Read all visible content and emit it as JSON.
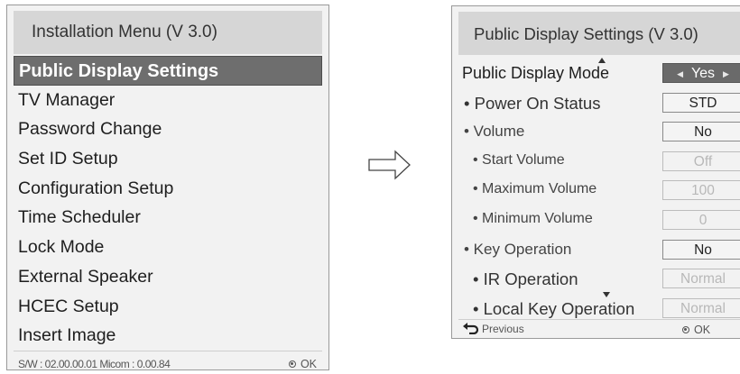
{
  "left_panel": {
    "title": "Installation Menu (V 3.0)",
    "items": [
      {
        "label": "Public Display Settings",
        "selected": true
      },
      {
        "label": "TV Manager"
      },
      {
        "label": "Password Change"
      },
      {
        "label": "Set ID Setup"
      },
      {
        "label": "Configuration Setup"
      },
      {
        "label": "Time Scheduler"
      },
      {
        "label": "Lock Mode"
      },
      {
        "label": "External Speaker"
      },
      {
        "label": "HCEC Setup"
      },
      {
        "label": "Insert Image"
      }
    ],
    "footer": {
      "version": "S/W : 02.00.00.01  Micom : 0.00.84",
      "ok_label": "OK"
    }
  },
  "arrow_icon": "right-hollow-arrow-icon",
  "right_panel": {
    "title": "Public Display Settings (V 3.0)",
    "rows": [
      {
        "label": "Public Display Mode",
        "value": "Yes"
      },
      {
        "label": "• Power On Status",
        "value": "STD"
      },
      {
        "label": "• Volume",
        "value": "No"
      },
      {
        "label": "• Start Volume",
        "value": "Off"
      },
      {
        "label": "• Maximum Volume",
        "value": "100"
      },
      {
        "label": "• Minimum Volume",
        "value": "0"
      },
      {
        "label": "• Key Operation",
        "value": "No"
      },
      {
        "label": "• IR Operation",
        "value": "Normal"
      },
      {
        "label": "• Local Key Operation",
        "value": "Normal"
      }
    ],
    "footer": {
      "previous_label": "Previous",
      "ok_label": "OK"
    }
  },
  "colors": {
    "selected_bg": "#6e6e6e",
    "header_bg": "#d6d6d6",
    "panel_bg": "#f2f2f2"
  }
}
